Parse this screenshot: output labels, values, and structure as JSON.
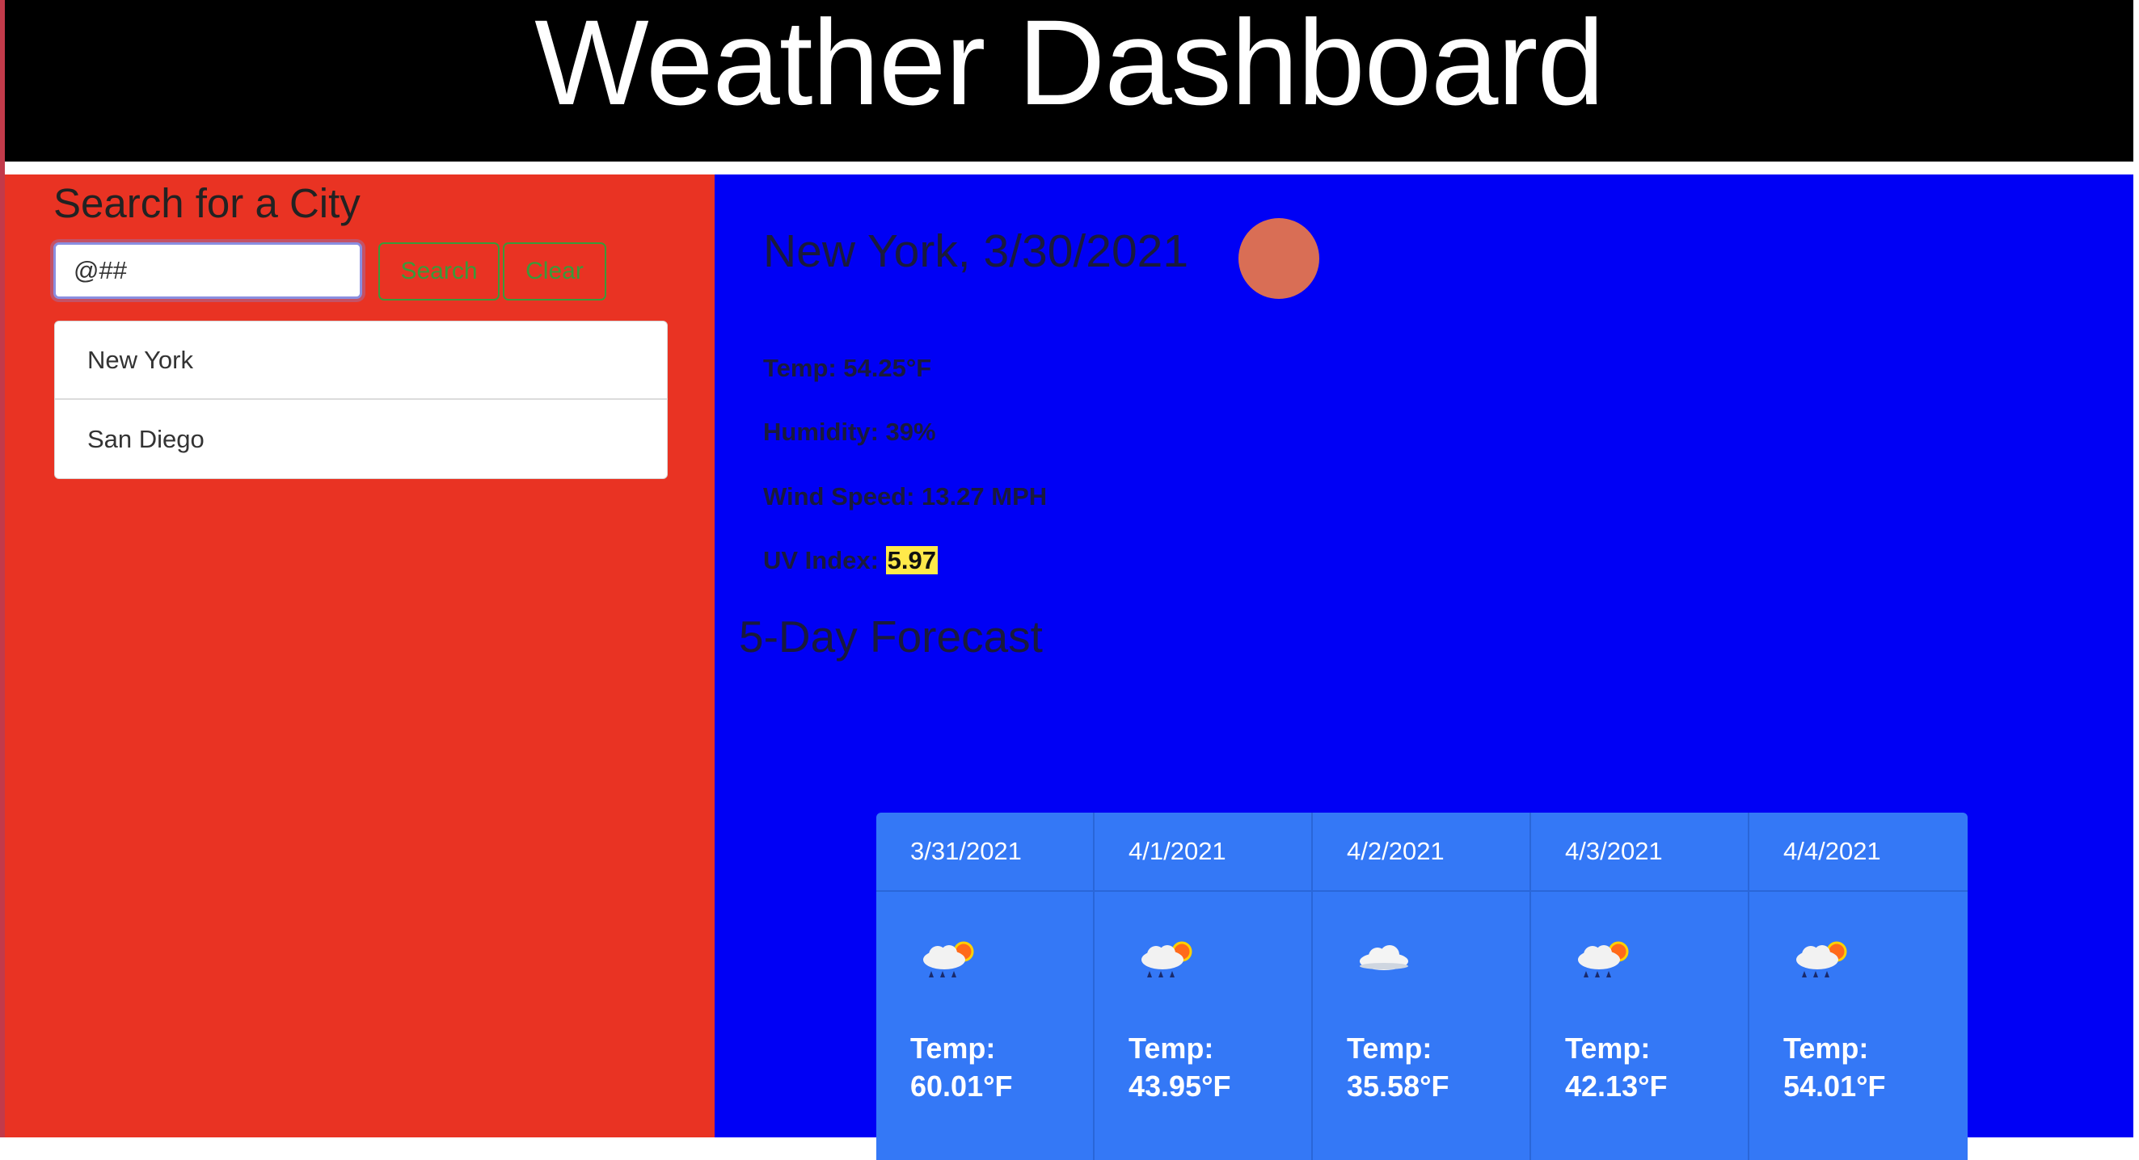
{
  "header": {
    "title": "Weather Dashboard"
  },
  "sidebar": {
    "heading": "Search for a City",
    "search": {
      "value": "@##",
      "placeholder": ""
    },
    "search_label": "Search",
    "clear_label": "Clear",
    "cities": [
      {
        "label": "New York"
      },
      {
        "label": "San Diego"
      }
    ]
  },
  "current": {
    "title": "New York, 3/30/2021",
    "icon": "weather-icon",
    "temp": "Temp: 54.25°F",
    "humidity": "Humidity: 39%",
    "wind": "Wind Speed: 13.27 MPH",
    "uv_label": "UV Index: ",
    "uv_value": "5.97"
  },
  "forecast": {
    "title": "5-Day Forecast",
    "temp_label": "Temp:",
    "days": [
      {
        "date": "3/31/2021",
        "icon": "rain-sun-icon",
        "temp": "60.01°F"
      },
      {
        "date": "4/1/2021",
        "icon": "rain-sun-icon",
        "temp": "43.95°F"
      },
      {
        "date": "4/2/2021",
        "icon": "cloud-icon",
        "temp": "35.58°F"
      },
      {
        "date": "4/3/2021",
        "icon": "rain-sun-icon",
        "temp": "42.13°F"
      },
      {
        "date": "4/4/2021",
        "icon": "rain-sun-icon",
        "temp": "54.01°F"
      }
    ]
  },
  "colors": {
    "header_bg": "#000000",
    "sidebar_bg": "#e93323",
    "main_bg": "#0000f5",
    "card_bg": "#3478f6",
    "uv_highlight": "#ffe94a",
    "button_text": "#3a9a3a"
  }
}
